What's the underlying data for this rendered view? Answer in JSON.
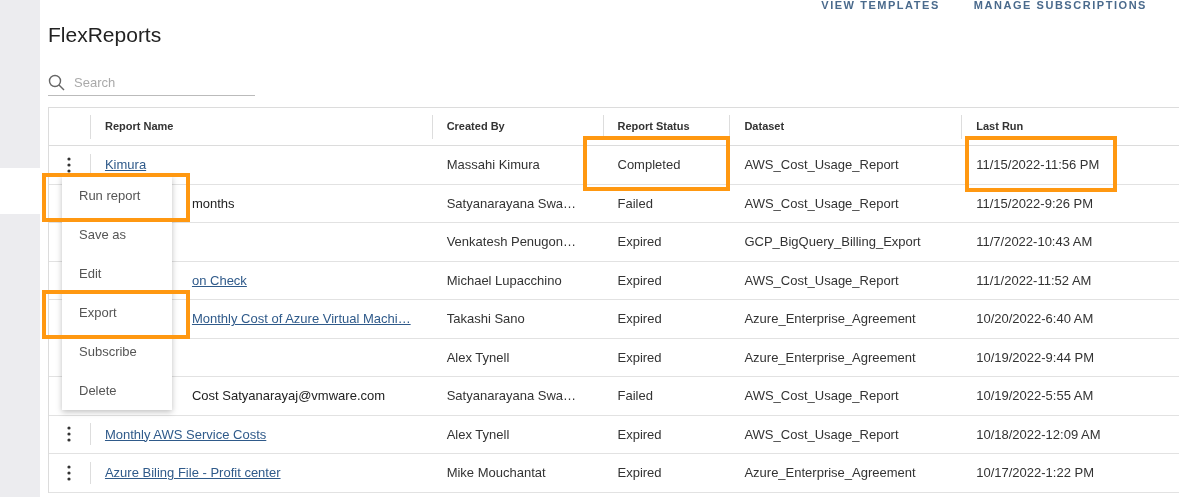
{
  "top_links": [
    "VIEW TEMPLATES",
    "MANAGE SUBSCRIPTIONS"
  ],
  "title": "FlexReports",
  "search": {
    "placeholder": "Search"
  },
  "table": {
    "columns": [
      "Report Name",
      "Created By",
      "Report Status",
      "Dataset",
      "Last Run"
    ],
    "rows": [
      {
        "name": "Kimura",
        "link": true,
        "covered_by_menu": false,
        "created_by": "Massahi Kimura",
        "status": "Completed",
        "status_highlighted": true,
        "dataset": "AWS_Cost_Usage_Report",
        "last_run": "11/15/2022-11:56 PM",
        "last_run_highlighted": true
      },
      {
        "name": "months",
        "link": false,
        "covered_by_menu": true,
        "created_by": "Satyanarayana Swa…",
        "status": "Failed",
        "status_highlighted": false,
        "dataset": "AWS_Cost_Usage_Report",
        "last_run": "11/15/2022-9:26 PM",
        "last_run_highlighted": false
      },
      {
        "created_by": "Venkatesh Penugon…",
        "status": "Expired",
        "status_highlighted": false,
        "dataset": "GCP_BigQuery_Billing_Export",
        "last_run": "11/7/2022-10:43 AM",
        "last_run_highlighted": false
      },
      {
        "name": "on Check",
        "link": true,
        "covered_by_menu": true,
        "created_by": "Michael Lupacchino",
        "status": "Expired",
        "status_highlighted": false,
        "dataset": "AWS_Cost_Usage_Report",
        "last_run": "11/1/2022-11:52 AM",
        "last_run_highlighted": false
      },
      {
        "name": "Monthly Cost of Azure Virtual Machi…",
        "link": true,
        "covered_by_menu": true,
        "created_by": "Takashi Sano",
        "status": "Expired",
        "status_highlighted": false,
        "dataset": "Azure_Enterprise_Agreement",
        "last_run": "10/20/2022-6:40 AM",
        "last_run_highlighted": false
      },
      {
        "created_by": "Alex Tynell",
        "status": "Expired",
        "status_highlighted": false,
        "dataset": "Azure_Enterprise_Agreement",
        "last_run": "10/19/2022-9:44 PM",
        "last_run_highlighted": false
      },
      {
        "name": "Cost Satyanarayaj@vmware.com",
        "link": false,
        "covered_by_menu": true,
        "created_by": "Satyanarayana Swa…",
        "status": "Failed",
        "status_highlighted": false,
        "dataset": "AWS_Cost_Usage_Report",
        "last_run": "10/19/2022-5:55 AM",
        "last_run_highlighted": false
      },
      {
        "name": "Monthly AWS Service Costs",
        "link": true,
        "covered_by_menu": false,
        "created_by": "Alex Tynell",
        "status": "Expired",
        "status_highlighted": false,
        "dataset": "AWS_Cost_Usage_Report",
        "last_run": "10/18/2022-12:09 AM",
        "last_run_highlighted": false
      },
      {
        "name": "Azure Biling File - Profit center",
        "link": true,
        "covered_by_menu": false,
        "created_by": "Mike Mouchantat",
        "status": "Expired",
        "status_highlighted": false,
        "dataset": "Azure_Enterprise_Agreement",
        "last_run": "10/17/2022-1:22 PM",
        "last_run_highlighted": false
      }
    ]
  },
  "row_menu": {
    "items": [
      {
        "label": "Run report",
        "highlighted": true
      },
      {
        "label": "Save as",
        "highlighted": false
      },
      {
        "label": "Edit",
        "highlighted": false
      },
      {
        "label": "Export",
        "highlighted": true
      },
      {
        "label": "Subscribe",
        "highlighted": false
      },
      {
        "label": "Delete",
        "highlighted": false
      }
    ]
  }
}
